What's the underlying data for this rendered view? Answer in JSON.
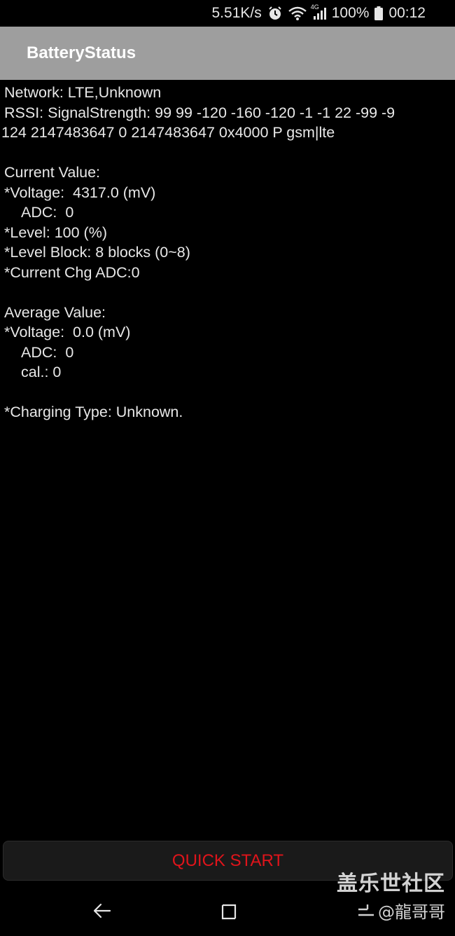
{
  "status_bar": {
    "net_speed": "5.51K/s",
    "network_badge": "4G",
    "battery_percent": "100%",
    "time": "00:12",
    "icons": [
      "alarm-icon",
      "wifi-icon",
      "cellular-signal-icon",
      "battery-icon"
    ]
  },
  "app_bar": {
    "title": "BatteryStatus"
  },
  "info": {
    "network": "Network: LTE,Unknown",
    "rssi_1": "RSSI: SignalStrength: 99 99 -120 -160 -120 -1 -1 22 -99 -9",
    "rssi_2": "124 2147483647 0 2147483647 0x4000 P gsm|lte",
    "current_header": "Current Value:",
    "current_voltage": "*Voltage:  4317.0 (mV)",
    "current_adc": "ADC:  0",
    "current_level": "*Level: 100 (%)",
    "current_level_block": "*Level Block: 8 blocks (0~8)",
    "current_chg_adc": "*Current Chg ADC:0",
    "average_header": "Average Value:",
    "average_voltage": "*Voltage:  0.0 (mV)",
    "average_adc": "ADC:  0",
    "average_cal": "cal.: 0",
    "charging_type": "*Charging Type: Unknown."
  },
  "quick_start": {
    "label": "QUICK START"
  },
  "nav_bar": {
    "icons": [
      "back-icon",
      "recents-icon"
    ]
  },
  "watermark": {
    "line1": "盖乐世社区",
    "line2": "@龍哥哥"
  },
  "colors": {
    "background": "#000000",
    "app_bar": "#9e9e9e",
    "quick_start_text": "#e0141b"
  }
}
